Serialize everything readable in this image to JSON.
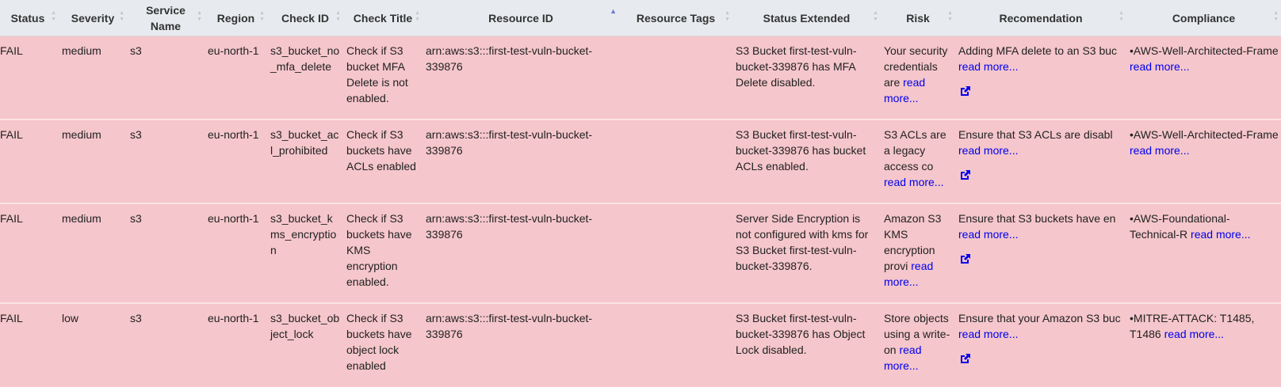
{
  "columns": [
    {
      "key": "status",
      "label": "Status"
    },
    {
      "key": "severity",
      "label": "Severity"
    },
    {
      "key": "service",
      "label": "Service Name"
    },
    {
      "key": "region",
      "label": "Region"
    },
    {
      "key": "check_id",
      "label": "Check ID"
    },
    {
      "key": "check_title",
      "label": "Check Title"
    },
    {
      "key": "resource_id",
      "label": "Resource ID"
    },
    {
      "key": "resource_tags",
      "label": "Resource Tags"
    },
    {
      "key": "status_extended",
      "label": "Status Extended"
    },
    {
      "key": "risk",
      "label": "Risk"
    },
    {
      "key": "recommendation",
      "label": "Recomendation"
    },
    {
      "key": "compliance",
      "label": "Compliance"
    }
  ],
  "sorted_column": "resource_id",
  "read_more_label": "read more...",
  "rows": [
    {
      "status": "FAIL",
      "severity": "medium",
      "service": "s3",
      "region": "eu-north-1",
      "check_id": "s3_bucket_no_mfa_delete",
      "check_title": "Check if S3 bucket MFA Delete is not enabled.",
      "resource_id": "arn:aws:s3:::first-test-vuln-bucket-339876",
      "resource_tags": "",
      "status_extended": "S3 Bucket first-test-vuln-bucket-339876 has MFA Delete disabled.",
      "risk": "Your security credentials are",
      "recommendation": "Adding MFA delete to an S3 buc",
      "compliance": "•AWS-Well-Architected-Framewo"
    },
    {
      "status": "FAIL",
      "severity": "medium",
      "service": "s3",
      "region": "eu-north-1",
      "check_id": "s3_bucket_acl_prohibited",
      "check_title": "Check if S3 buckets have ACLs enabled",
      "resource_id": "arn:aws:s3:::first-test-vuln-bucket-339876",
      "resource_tags": "",
      "status_extended": "S3 Bucket first-test-vuln-bucket-339876 has bucket ACLs enabled.",
      "risk": "S3 ACLs are a legacy access co",
      "recommendation": "Ensure that S3 ACLs are disabl",
      "compliance": "•AWS-Well-Architected-Framewo"
    },
    {
      "status": "FAIL",
      "severity": "medium",
      "service": "s3",
      "region": "eu-north-1",
      "check_id": "s3_bucket_kms_encryption",
      "check_title": "Check if S3 buckets have KMS encryption enabled.",
      "resource_id": "arn:aws:s3:::first-test-vuln-bucket-339876",
      "resource_tags": "",
      "status_extended": "Server Side Encryption is not configured with kms for S3 Bucket first-test-vuln-bucket-339876.",
      "risk": "Amazon S3 KMS encryption provi",
      "recommendation": "Ensure that S3 buckets have en",
      "compliance": "•AWS-Foundational-Technical-R"
    },
    {
      "status": "FAIL",
      "severity": "low",
      "service": "s3",
      "region": "eu-north-1",
      "check_id": "s3_bucket_object_lock",
      "check_title": "Check if S3 buckets have object lock enabled",
      "resource_id": "arn:aws:s3:::first-test-vuln-bucket-339876",
      "resource_tags": "",
      "status_extended": "S3 Bucket first-test-vuln-bucket-339876 has Object Lock disabled.",
      "risk": "Store objects using a write-on",
      "recommendation": "Ensure that your Amazon S3 buc",
      "compliance": "•MITRE-ATTACK: T1485, T1486"
    }
  ]
}
